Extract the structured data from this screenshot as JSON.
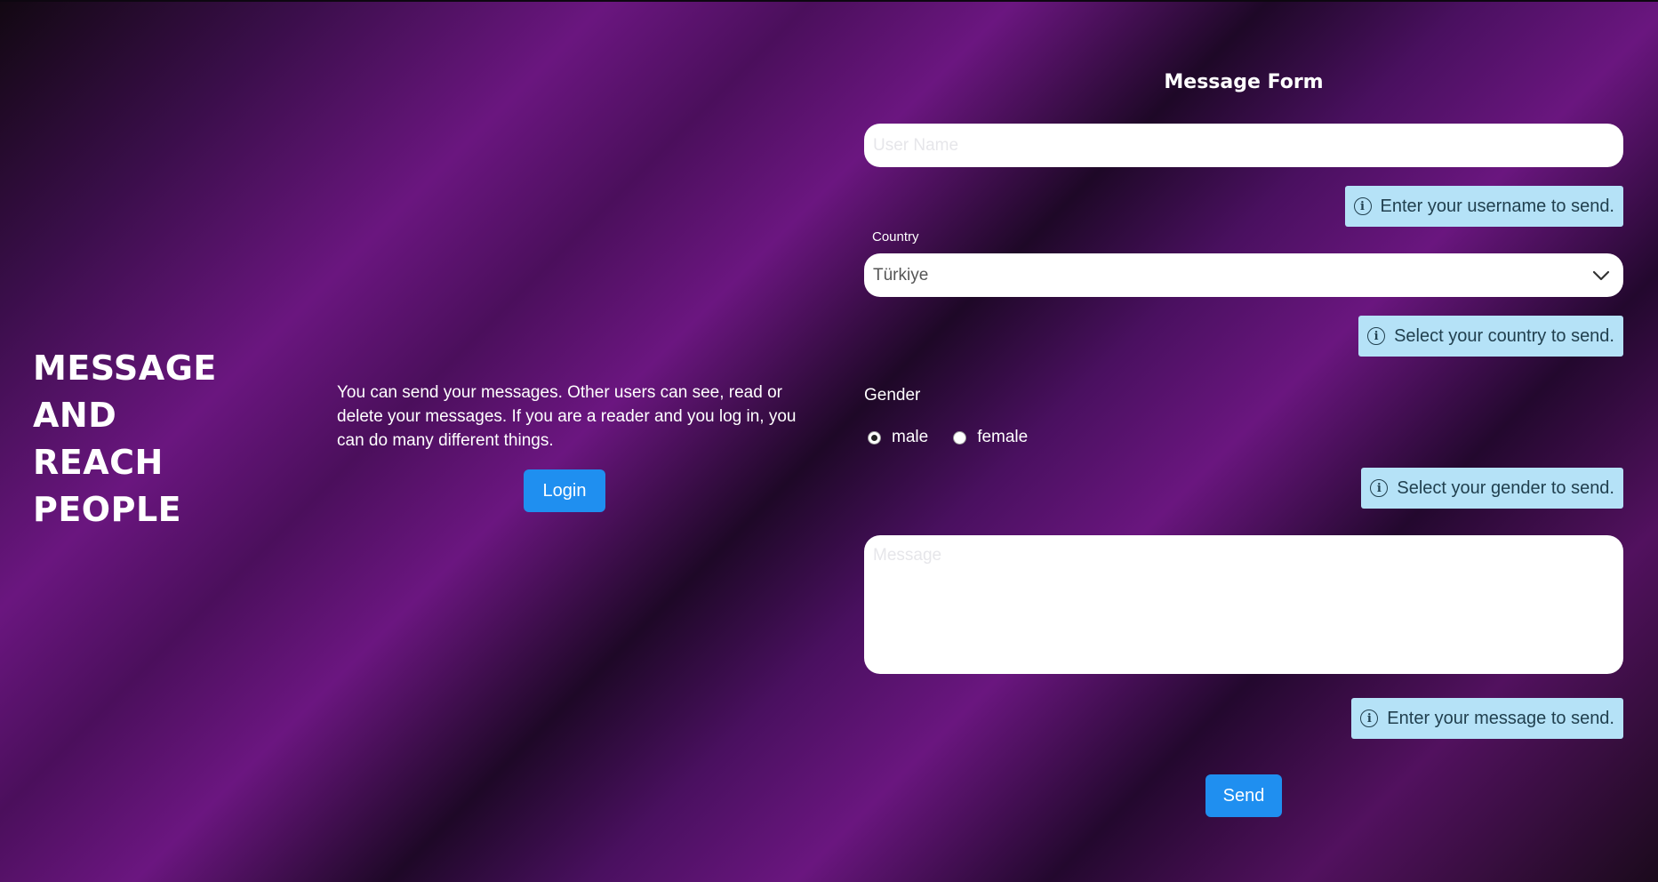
{
  "hero": {
    "lines": [
      "MESSAGE",
      "AND",
      "REACH",
      "PEOPLE"
    ]
  },
  "intro": {
    "text": "You can send your messages. Other users can see, read or delete your messages. If you are a reader and you log in, you can do many different things.",
    "login_label": "Login"
  },
  "form": {
    "title": "Message Form",
    "username_placeholder": "User Name",
    "username_hint": "Enter your username to send.",
    "country_label": "Country",
    "country_value": "Türkiye",
    "country_hint": "Select your country to send.",
    "gender_label": "Gender",
    "gender_options": [
      "male",
      "female"
    ],
    "gender_selected": "male",
    "gender_hint": "Select your gender to send.",
    "message_placeholder": "Message",
    "message_hint": "Enter your message to send.",
    "send_label": "Send"
  },
  "icons": {
    "info": "info-circle-icon",
    "dropdown": "chevron-down-icon"
  },
  "colors": {
    "accent": "#1f8ff0",
    "hint_bg": "#b5e2f7",
    "hint_text": "#21404f"
  }
}
